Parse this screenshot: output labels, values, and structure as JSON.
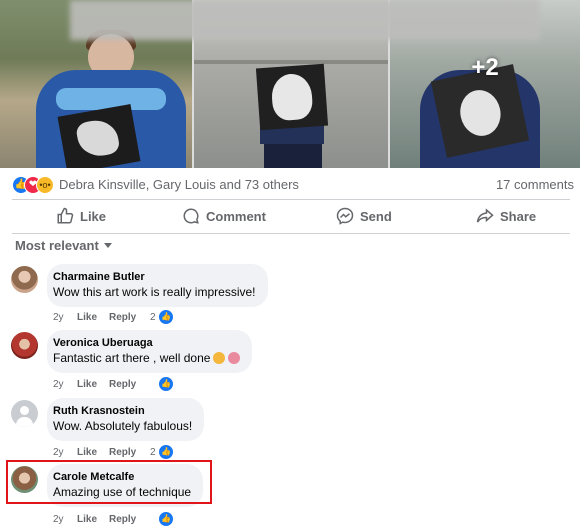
{
  "post": {
    "photos_more": "+2"
  },
  "reactions": {
    "icons": [
      "like-icon",
      "love-icon",
      "wow-icon"
    ],
    "names": "Debra Kinsville, Gary Louis and 73 others",
    "comment_count": "17 comments"
  },
  "actions": {
    "like": "Like",
    "comment": "Comment",
    "send": "Send",
    "share": "Share"
  },
  "sort": {
    "label": "Most relevant"
  },
  "comments": [
    {
      "name": "Charmaine Butler",
      "text": "Wow this art work is really impressive!",
      "age": "2y",
      "like": "Like",
      "reply": "Reply",
      "reaction_count": "2"
    },
    {
      "name": "Veronica Uberuaga",
      "text": "Fantastic art there , well done",
      "age": "2y",
      "like": "Like",
      "reply": "Reply",
      "reaction_count": ""
    },
    {
      "name": "Ruth Krasnostein",
      "text": "Wow. Absolutely fabulous!",
      "age": "2y",
      "like": "Like",
      "reply": "Reply",
      "reaction_count": "2"
    },
    {
      "name": "Carole Metcalfe",
      "text": "Amazing use of technique",
      "age": "2y",
      "like": "Like",
      "reply": "Reply",
      "reaction_count": ""
    }
  ],
  "colors": {
    "accent": "#1877f2",
    "highlight": "#e0151a",
    "bubble": "#f0f2f5",
    "muted_text": "#65676b"
  }
}
